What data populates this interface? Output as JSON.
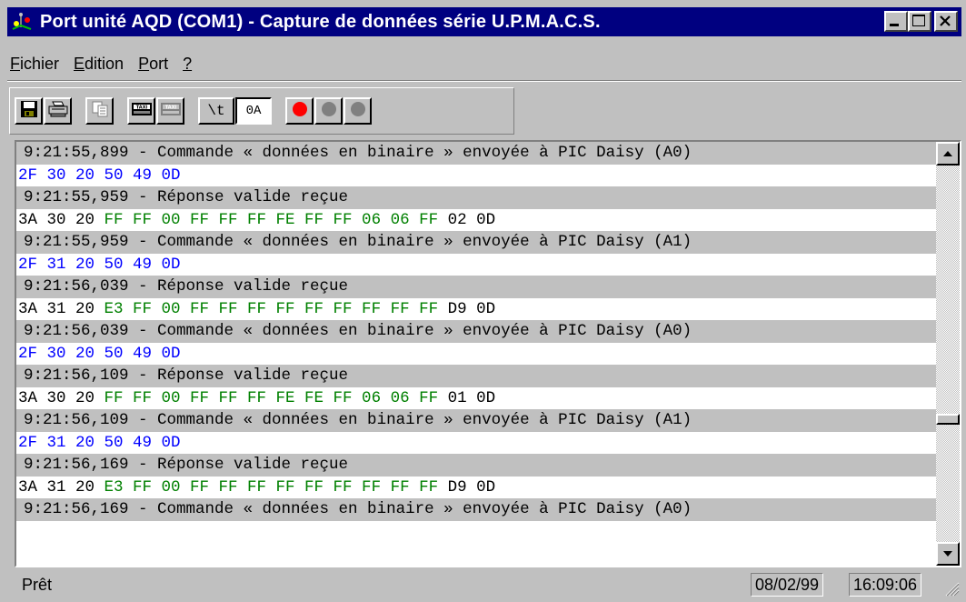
{
  "window": {
    "title": "Port unité AQD (COM1) - Capture de données série U.P.M.A.C.S.",
    "buttons": [
      "minimize",
      "maximize",
      "close"
    ]
  },
  "menu": {
    "items": [
      {
        "accel": "F",
        "rest": "ichier"
      },
      {
        "accel": "E",
        "rest": "dition"
      },
      {
        "accel": "P",
        "rest": "ort"
      },
      {
        "accel": "?",
        "rest": ""
      }
    ]
  },
  "toolbar": {
    "icons": [
      "save-icon",
      "print-icon",
      "copy-icon",
      "taxi-icon",
      "taxi-disabled-icon",
      "record-red-icon",
      "record-gray-icon",
      "record-gray-icon"
    ],
    "tab_label": "\\t",
    "hex_label": "0A",
    "colors": {
      "record": "#ff0000",
      "disabled": "#808080"
    }
  },
  "log": {
    "colors": {
      "header_bg": "#c0c0c0",
      "sent": "#0000ff",
      "payload": "#008000",
      "text": "#000000"
    },
    "rows": [
      {
        "kind": "header",
        "text": "9:21:55,899 - Commande « données en binaire » envoyée à PIC Daisy (A0)"
      },
      {
        "kind": "sent",
        "text": "2F 30 20 50 49 0D"
      },
      {
        "kind": "header",
        "text": "9:21:55,959 - Réponse valide reçue"
      },
      {
        "kind": "recv",
        "prefix": "3A 30 20 ",
        "payload": "FF FF 00 FF FF FF FE FF FF 06 06 FF",
        "suffix": " 02 0D"
      },
      {
        "kind": "header",
        "text": "9:21:55,959 - Commande « données en binaire » envoyée à PIC Daisy (A1)"
      },
      {
        "kind": "sent",
        "text": "2F 31 20 50 49 0D"
      },
      {
        "kind": "header",
        "text": "9:21:56,039 - Réponse valide reçue"
      },
      {
        "kind": "recv",
        "prefix": "3A 31 20 ",
        "payload": "E3 FF 00 FF FF FF FF FF FF FF FF FF",
        "suffix": " D9 0D"
      },
      {
        "kind": "header",
        "text": "9:21:56,039 - Commande « données en binaire » envoyée à PIC Daisy (A0)"
      },
      {
        "kind": "sent",
        "text": "2F 30 20 50 49 0D"
      },
      {
        "kind": "header",
        "text": "9:21:56,109 - Réponse valide reçue"
      },
      {
        "kind": "recv",
        "prefix": "3A 30 20 ",
        "payload": "FF FF 00 FF FF FF FE FE FF 06 06 FF",
        "suffix": " 01 0D"
      },
      {
        "kind": "header",
        "text": "9:21:56,109 - Commande « données en binaire » envoyée à PIC Daisy (A1)"
      },
      {
        "kind": "sent",
        "text": "2F 31 20 50 49 0D"
      },
      {
        "kind": "header",
        "text": "9:21:56,169 - Réponse valide reçue"
      },
      {
        "kind": "recv",
        "prefix": "3A 31 20 ",
        "payload": "E3 FF 00 FF FF FF FF FF FF FF FF FF",
        "suffix": " D9 0D"
      },
      {
        "kind": "header",
        "text": "9:21:56,169 - Commande « données en binaire » envoyée à PIC Daisy (A0)"
      }
    ]
  },
  "scrollbar": {
    "position_fraction": 0.68
  },
  "status": {
    "text": "Prêt",
    "date": "08/02/99",
    "time": "16:09:06"
  }
}
